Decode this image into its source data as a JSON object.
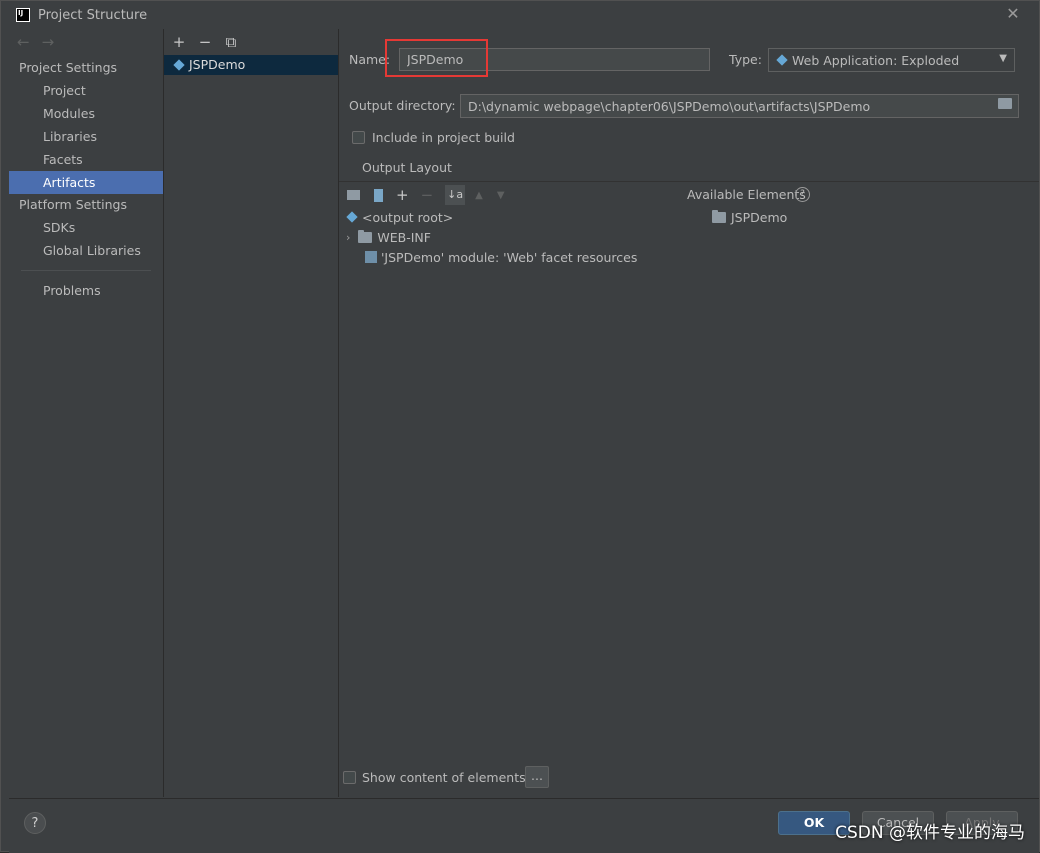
{
  "window": {
    "title": "Project Structure"
  },
  "left_nav": {
    "sections": [
      {
        "title": "Project Settings",
        "items": [
          "Project",
          "Modules",
          "Libraries",
          "Facets",
          "Artifacts"
        ]
      },
      {
        "title": "Platform Settings",
        "items": [
          "SDKs",
          "Global Libraries"
        ]
      }
    ],
    "selected": "Artifacts",
    "problems": "Problems"
  },
  "artifacts": {
    "items": [
      "JSPDemo"
    ]
  },
  "form": {
    "name_label": "Name:",
    "name_value": "JSPDemo",
    "type_label": "Type:",
    "type_value": "Web Application: Exploded",
    "output_label": "Output directory:",
    "output_value": "D:\\dynamic webpage\\chapter06\\JSPDemo\\out\\artifacts\\JSPDemo",
    "include_build": "Include in project build",
    "output_layout_tab": "Output Layout",
    "available_elements": "Available Elements",
    "tree": [
      "<output root>",
      "WEB-INF",
      "'JSPDemo' module: 'Web' facet resources"
    ],
    "available_items": [
      "JSPDemo"
    ],
    "show_content": "Show content of elements",
    "more_button": "..."
  },
  "footer": {
    "help": "?",
    "ok": "OK",
    "cancel": "Cancel",
    "apply": "Apply"
  },
  "watermark": "CSDN @软件专业的海马",
  "colors": {
    "selection": "#4b6eaf",
    "highlight": "#e53935",
    "primary_button": "#365880"
  }
}
